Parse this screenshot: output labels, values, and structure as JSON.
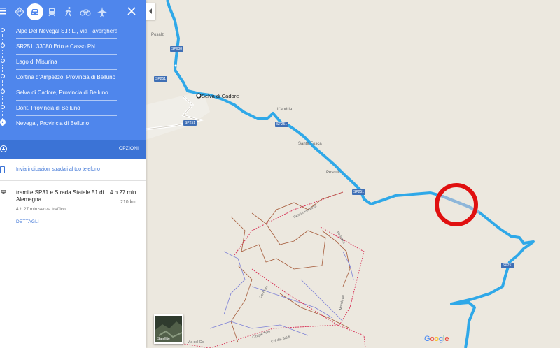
{
  "colors": {
    "header_blue": "#4f86ec",
    "options_blue": "#3b73d6",
    "route_blue": "#2fa8e8",
    "trail_red": "#d8375a",
    "trail_brown": "#a55b3a",
    "annotation_red": "#e01010"
  },
  "modes": [
    {
      "name": "best-route",
      "icon": "diamond-route-icon"
    },
    {
      "name": "car",
      "icon": "car-icon",
      "active": true
    },
    {
      "name": "transit",
      "icon": "train-icon"
    },
    {
      "name": "walk",
      "icon": "walking-icon"
    },
    {
      "name": "bike",
      "icon": "bicycle-icon"
    },
    {
      "name": "flight",
      "icon": "airplane-icon"
    }
  ],
  "stops": [
    "Alpe Del Nevegal S.R.L., Via Faverghera,",
    "SR251, 33080 Erto e Casso PN",
    "Lago di Misurina",
    "Cortina d'Ampezzo, Provincia di Belluno",
    "Selva di Cadore, Provincia di Belluno",
    "Dont, Provincia di Belluno",
    "Nevegal, Provincia di Belluno"
  ],
  "options_label": "OPZIONI",
  "send_label": "Invia indicazioni stradali al tuo telefono",
  "route": {
    "name": "tramite SP31 e Strada Statale 51 di Alemagna",
    "time": "4 h 27 min",
    "distance": "210 km",
    "traffic": "4 h 27 min senza traffico",
    "details": "DETTAGLI"
  },
  "map": {
    "town": "Selva di Cadore",
    "places": [
      "Posalz",
      "L'andria",
      "Santa Fosca",
      "Pescul"
    ],
    "shields": [
      "SP638",
      "SP251",
      "SP251",
      "SP251",
      "SP251",
      "SP251"
    ],
    "trails": [
      "Pescul-Fertazza",
      "Col Fiere",
      "Cinque Torri",
      "Col dei Baldi",
      "Fertazza",
      "Mondeval",
      "Via del Col"
    ],
    "satellite_label": "Satellite",
    "logo": "Google"
  }
}
